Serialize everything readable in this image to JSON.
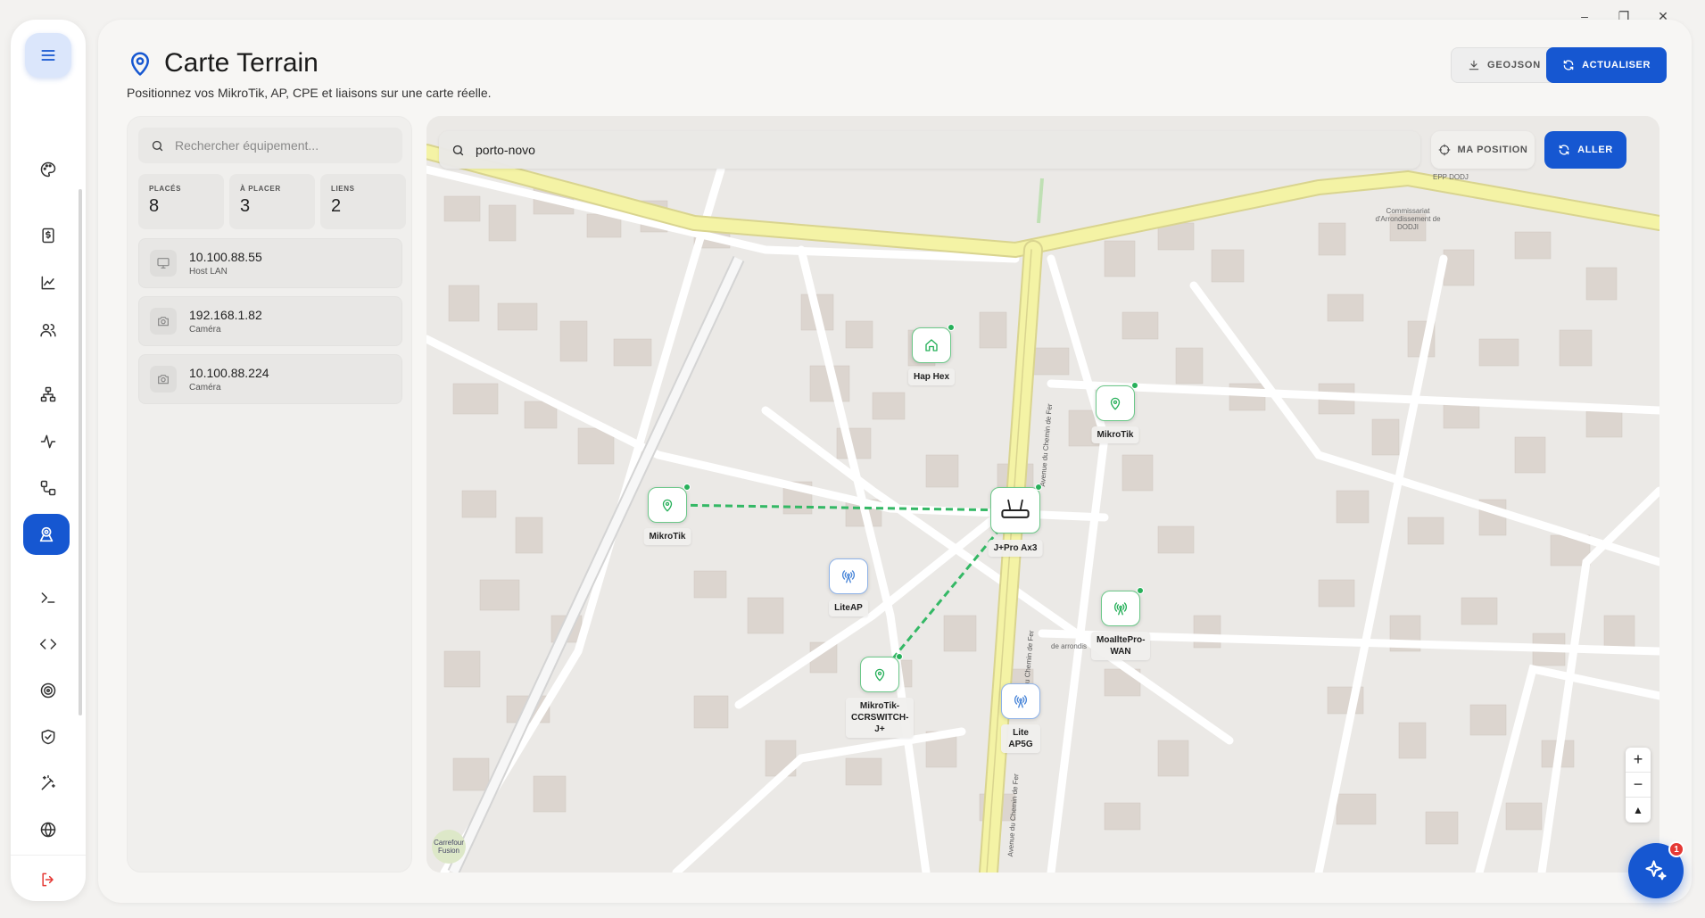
{
  "window": {
    "minimize": "–",
    "restore": "❐",
    "close": "✕"
  },
  "header": {
    "title": "Carte Terrain",
    "subtitle": "Positionnez vos MikroTik, AP, CPE et liaisons sur une carte réelle.",
    "geojson_label": "GEOJSON",
    "refresh_label": "ACTUALISER"
  },
  "sidebar": {
    "items": [
      "menu",
      "palette",
      "billing",
      "chart",
      "users",
      "network",
      "activity",
      "workflow",
      "map",
      "terminal",
      "code",
      "target",
      "shield",
      "magic",
      "globe",
      "logout"
    ],
    "active": "map",
    "colors": {
      "active": "#1657d1",
      "logout": "#e53935"
    }
  },
  "equipment_panel": {
    "search_placeholder": "Rechercher équipement...",
    "stats": [
      {
        "label": "PLACÉS",
        "value": "8"
      },
      {
        "label": "À PLACER",
        "value": "3"
      },
      {
        "label": "LIENS",
        "value": "2"
      }
    ],
    "unplaced": [
      {
        "ip": "10.100.88.55",
        "type": "Host LAN",
        "icon": "monitor-icon"
      },
      {
        "ip": "192.168.1.82",
        "type": "Caméra",
        "icon": "camera-icon"
      },
      {
        "ip": "10.100.88.224",
        "type": "Caméra",
        "icon": "camera-icon"
      }
    ]
  },
  "map": {
    "search_value": "porto-novo",
    "my_position_label": "MA POSITION",
    "go_label": "ALLER",
    "zoom_in": "+",
    "zoom_out": "−",
    "compass": "▲",
    "poi_label": "Carrefour Fusion",
    "place_labels": {
      "epp": "EPP DODJ",
      "commissariat": "Commissariat d'Arrondissement de DODJI",
      "arrondis": "de arrondis",
      "road1": "Avenue du Chemin de Fer",
      "road2": "Avenue du Chemin de Fer",
      "road3": "du Chemin de Fer"
    },
    "nodes": [
      {
        "name": "Hap Hex",
        "icon": "home-icon",
        "status": "online"
      },
      {
        "name": "MikroTik",
        "icon": "pin-icon",
        "status": "online"
      },
      {
        "name": "MikroTik",
        "icon": "pin-icon",
        "status": "online"
      },
      {
        "name": "J+Pro Ax3",
        "icon": "router-icon",
        "status": "online"
      },
      {
        "name": "LiteAP",
        "icon": "antenna-icon",
        "status": "unknown"
      },
      {
        "name": "MoaIltePro-WAN",
        "icon": "antenna-icon",
        "status": "online"
      },
      {
        "name": "MikroTik-CCRSWITCH-J+",
        "icon": "pin-icon",
        "status": "online"
      },
      {
        "name": "Lite AP5G",
        "icon": "antenna-icon",
        "status": "unknown"
      }
    ],
    "links": [
      {
        "from": "MikroTik",
        "to": "J+Pro Ax3"
      },
      {
        "from": "J+Pro Ax3",
        "to": "MikroTik-CCRSWITCH-J+"
      }
    ],
    "colors": {
      "online": "#27b05a",
      "link": "#34b865",
      "unknown": "#4a86d8",
      "major_road": "#f4f3a5"
    }
  },
  "assistant": {
    "badge": "1"
  }
}
